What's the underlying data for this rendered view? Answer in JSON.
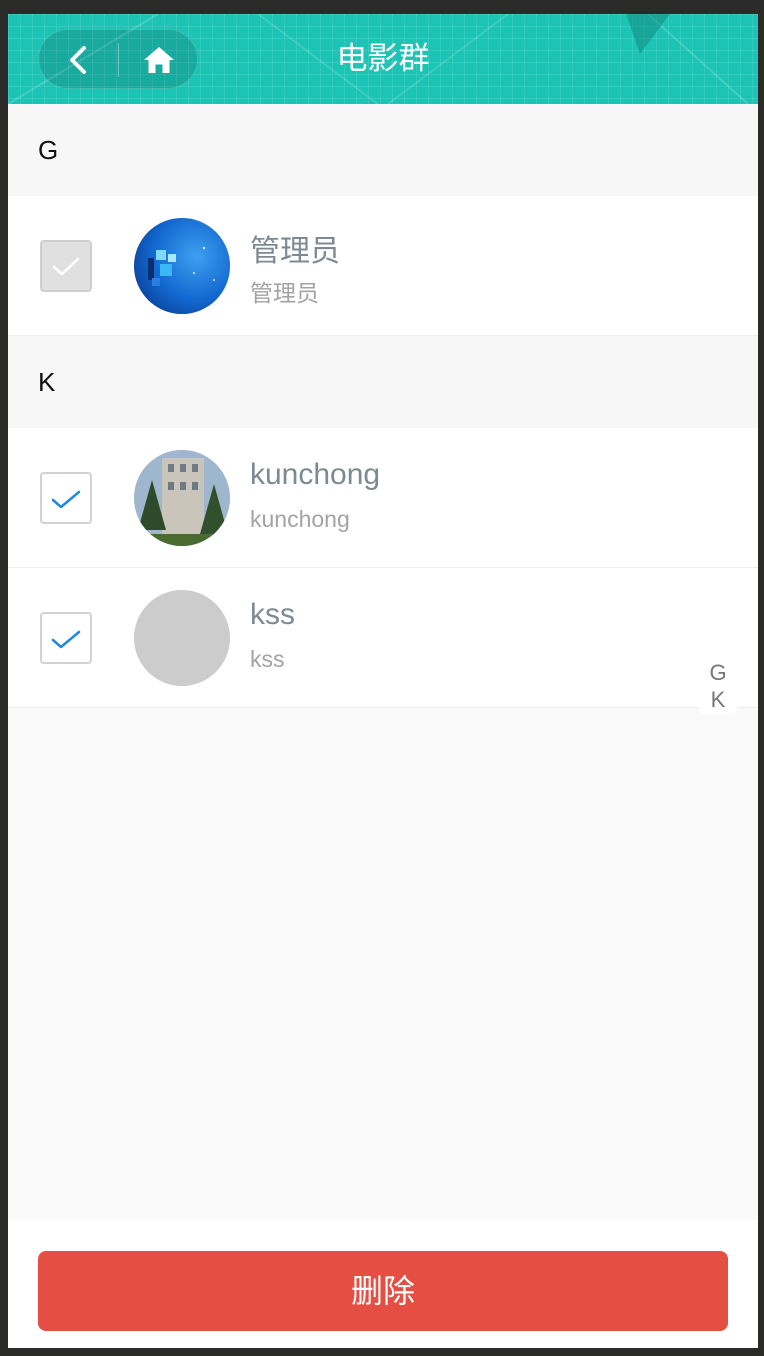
{
  "header": {
    "title": "电影群",
    "back_icon": "chevron-left-icon",
    "home_icon": "home-icon",
    "bg_color": "#1cc4b6"
  },
  "sections": [
    {
      "letter": "G",
      "members": [
        {
          "name": "管理员",
          "subtitle": "管理员",
          "checked": true,
          "disabled": true,
          "avatar": "blue-abstract-avatar"
        }
      ]
    },
    {
      "letter": "K",
      "members": [
        {
          "name": "kunchong",
          "subtitle": "kunchong",
          "checked": true,
          "disabled": false,
          "avatar": "building-photo-avatar"
        },
        {
          "name": "kss",
          "subtitle": "kss",
          "checked": true,
          "disabled": false,
          "avatar": "placeholder-avatar"
        }
      ]
    }
  ],
  "index_bar": [
    "G",
    "K"
  ],
  "footer": {
    "delete_label": "删除",
    "delete_color": "#e44e43"
  }
}
